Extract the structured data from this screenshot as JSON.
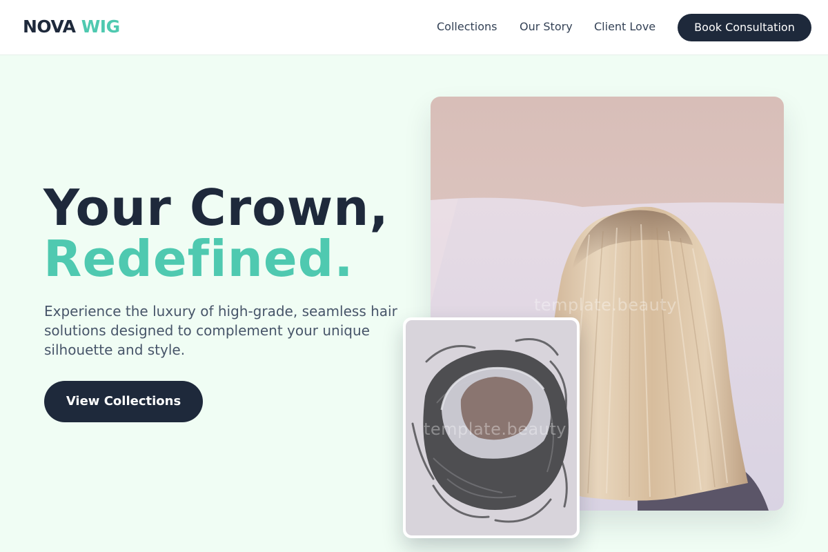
{
  "brand": {
    "name_part1": "NOVA",
    "name_part2": "WIG"
  },
  "nav": {
    "links": [
      "Collections",
      "Our Story",
      "Client Love"
    ],
    "cta": "Book Consultation"
  },
  "hero": {
    "title_line1": "Your Crown,",
    "title_line2": "Redefined.",
    "subtitle": "Experience the luxury of high-grade, seamless hair solutions designed to complement your unique silhouette and style.",
    "button": "View Collections"
  },
  "images": {
    "watermark": "template.beauty"
  },
  "colors": {
    "accent": "#4fc9b0",
    "dark": "#1e293b",
    "background": "#f0fdf4"
  }
}
